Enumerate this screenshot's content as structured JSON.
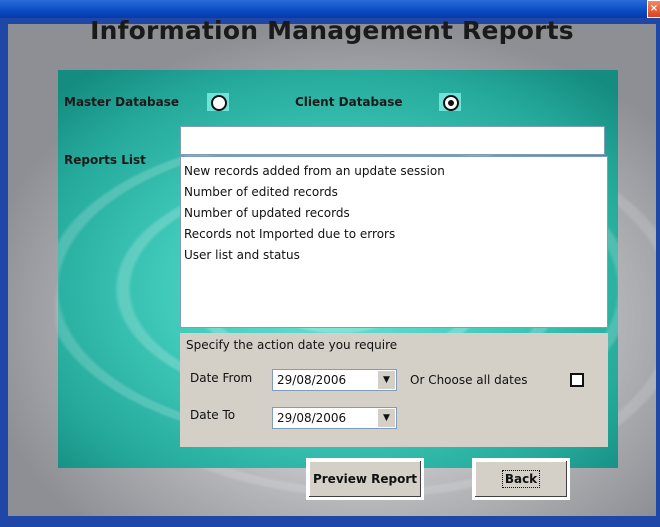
{
  "window": {
    "close_glyph": "×"
  },
  "title": "Information Management Reports",
  "database": {
    "master_label": "Master Database",
    "client_label": "Client Database",
    "selected": "client"
  },
  "reports": {
    "label": "Reports List",
    "search_value": "",
    "items": [
      "New records added from an update session",
      "Number of edited records",
      "Number of updated records",
      "Records not Imported due to errors",
      "User list and status"
    ]
  },
  "dates": {
    "heading": "Specify the action date you require",
    "from_label": "Date From",
    "from_value": "29/08/2006",
    "to_label": "Date To",
    "to_value": "29/08/2006",
    "all_dates_label": "Or Choose all dates",
    "all_dates_checked": false
  },
  "buttons": {
    "preview": "Preview Report",
    "back": "Back"
  }
}
